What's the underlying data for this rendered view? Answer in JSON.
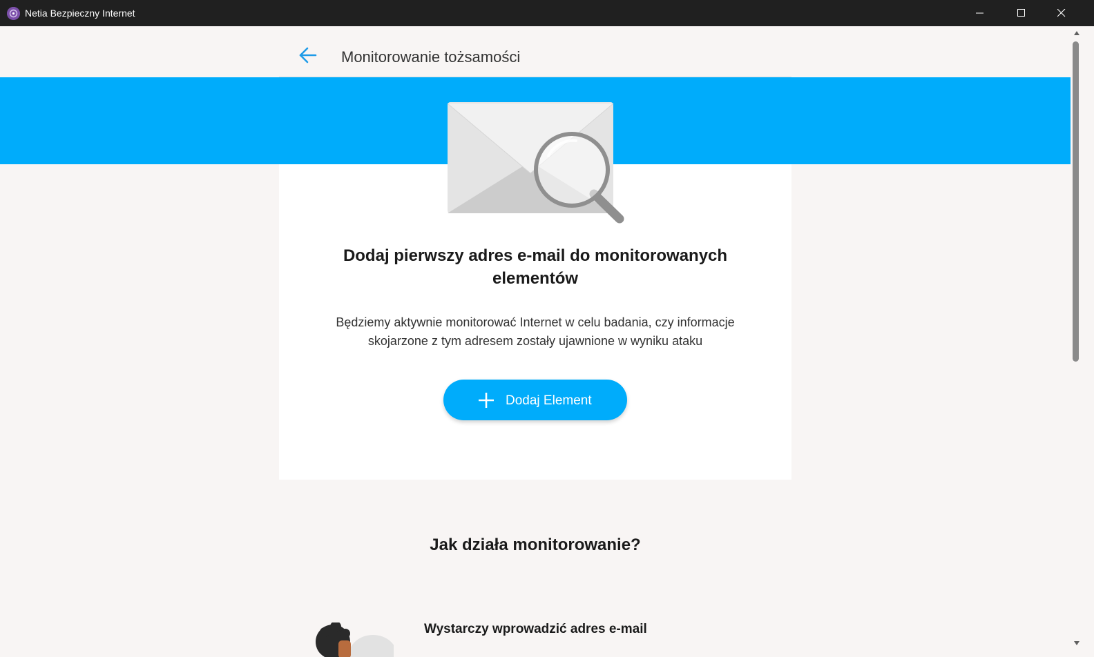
{
  "window": {
    "title": "Netia Bezpieczny Internet",
    "controls": [
      "minimize-icon",
      "maximize-icon",
      "close-icon"
    ]
  },
  "header": {
    "back_icon": "arrow-left-icon",
    "title": "Monitorowanie tożsamości"
  },
  "card": {
    "illustration": "envelope-magnifier-illustration",
    "title_line1": "Dodaj pierwszy adres e-mail do monitorowanych",
    "title_line2": "elementów",
    "description_line1": "Będziemy aktywnie monitorować Internet w celu badania, czy informacje",
    "description_line2": "skojarzone z tym adresem zostały ujawnione w wyniku ataku",
    "add_button": {
      "icon": "plus-icon",
      "label": "Dodaj Element"
    }
  },
  "how_section": {
    "title": "Jak działa monitorowanie?",
    "steps": [
      {
        "title": "Wystarczy wprowadzić adres e-mail"
      }
    ]
  },
  "colors": {
    "accent": "#00acfb",
    "titlebar": "#202020",
    "background": "#f8f5f4",
    "card": "#ffffff",
    "text": "#1a1a1a"
  }
}
